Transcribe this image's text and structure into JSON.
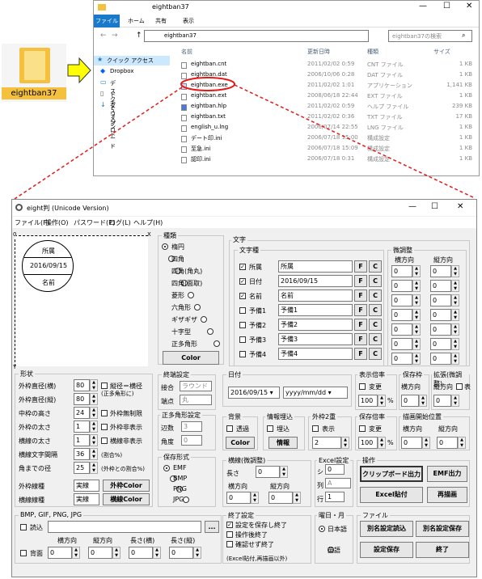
{
  "desktop_icon_label": "eightban37",
  "explorer": {
    "title": "eightban37",
    "tabs": [
      "ファイル",
      "ホーム",
      "共有",
      "表示"
    ],
    "path": "eightban37",
    "search_placeholder": "eightban37の検索",
    "col_name": "名前",
    "col_date": "更新日時",
    "col_type": "種類",
    "col_size": "サイズ",
    "nav": [
      "クイック アクセス",
      "Dropbox",
      "デスクトップ",
      "ドキュメント",
      "ダウンロード"
    ],
    "files": [
      {
        "name": "eightban.cnt",
        "date": "2011/02/02 0:59",
        "type": "CNT ファイル",
        "size": "1 KB"
      },
      {
        "name": "eightban.dat",
        "date": "2006/10/06 0:28",
        "type": "DAT ファイル",
        "size": "1 KB"
      },
      {
        "name": "eightban.exe",
        "date": "2011/02/02 1:01",
        "type": "アプリケーション",
        "size": "1,141 KB"
      },
      {
        "name": "eightban.ext",
        "date": "2008/06/18 22:44",
        "type": "EXT ファイル",
        "size": "1 KB"
      },
      {
        "name": "eightban.hlp",
        "date": "2011/02/02 0:59",
        "type": "ヘルプ ファイル",
        "size": "239 KB"
      },
      {
        "name": "eightban.txt",
        "date": "2011/02/02 0:36",
        "type": "TXT ファイル",
        "size": "17 KB"
      },
      {
        "name": "english_u.lng",
        "date": "2006/07/14 22:55",
        "type": "LNG ファイル",
        "size": "1 KB"
      },
      {
        "name": "デート印.ini",
        "date": "2006/07/18 15:00",
        "type": "構成設定",
        "size": "1 KB"
      },
      {
        "name": "至急.ini",
        "date": "2006/07/18 15:09",
        "type": "構成設定",
        "size": "1 KB"
      },
      {
        "name": "認印.ini",
        "date": "2006/07/18 0:31",
        "type": "構成設定",
        "size": "1 KB"
      }
    ]
  },
  "app": {
    "title": "eight判 (Unicode Version)",
    "menu": [
      "ファイル(F)",
      "操作(O)",
      "パスワード(P)",
      "ログ(L)",
      "ヘルプ(H)"
    ],
    "preview": {
      "x_label": "X",
      "y_label": "Y",
      "o_label": "0",
      "top": "所属",
      "date": "2016/09/15",
      "bottom": "名前"
    },
    "shape": {
      "title": "種類",
      "options": [
        "楕円",
        "四角",
        "四角(角丸)",
        "四角(面取)",
        "菱形",
        "六角形",
        "ギザギザ",
        "十字型",
        "正多角形"
      ],
      "color_btn": "Color"
    },
    "text": {
      "title": "文字",
      "kind": "文字種",
      "rows": [
        {
          "on": true,
          "label": "所属",
          "value": "所属"
        },
        {
          "on": true,
          "label": "日付",
          "value": "2016/09/15"
        },
        {
          "on": true,
          "label": "名前",
          "value": "名前"
        },
        {
          "on": false,
          "label": "予備1",
          "value": "予備1"
        },
        {
          "on": false,
          "label": "予備2",
          "value": "予備2"
        },
        {
          "on": false,
          "label": "予備3",
          "value": "予備3"
        },
        {
          "on": false,
          "label": "予備4",
          "value": "予備4"
        }
      ],
      "f": "F",
      "c": "C",
      "adjust": "微調整",
      "horiz": "横方向",
      "vert": "縦方向",
      "zero": "0"
    },
    "form": {
      "title": "形状",
      "rows": [
        {
          "label": "外枠直径(横)",
          "value": "80",
          "chk": "縦径＝横径",
          "chk2": "(正多角形に)"
        },
        {
          "label": "外枠直径(縦)",
          "value": "80"
        },
        {
          "label": "中枠の高さ",
          "value": "24",
          "chk": "外枠無制限"
        },
        {
          "label": "外枠の太さ",
          "value": "1",
          "chk": "外枠非表示"
        },
        {
          "label": "横線の太さ",
          "value": "1",
          "chk": "横線非表示"
        },
        {
          "label": "横線文字間隔",
          "value": "36",
          "note": "(割合%)"
        },
        {
          "label": "角までの径",
          "value": "25",
          "note": "(外枠との割合%)"
        }
      ],
      "outer_line": "外枠線種",
      "outer_val": "実線",
      "outer_btn": "外枠Color",
      "h_line": "横線線種",
      "h_val": "実線",
      "h_btn": "横線Color"
    },
    "terminal": {
      "title": "終端設定",
      "join": "接合",
      "join_val": "ラウンド",
      "end": "端点",
      "end_val": "丸"
    },
    "polygon": {
      "title": "正多角形設定",
      "sides": "辺数",
      "sides_val": "3",
      "angle": "角度",
      "angle_val": "0"
    },
    "save_fmt": {
      "title": "保存形式",
      "options": [
        "EMF",
        "BMP",
        "PNG",
        "JPG"
      ]
    },
    "date": {
      "title": "日付",
      "value": "2016/09/15",
      "fmt": "yyyy/mm/dd"
    },
    "bg": {
      "title": "背景",
      "transparent": "透過",
      "color": "Color"
    },
    "info": {
      "title": "情報埋込",
      "embed": "埋込",
      "btn": "情報"
    },
    "double": {
      "title": "外枠2重",
      "show": "表示",
      "value": "2"
    },
    "hline_adj": {
      "title": "横線(微調整)",
      "len": "長さ",
      "len_val": "0",
      "horiz": "横方向",
      "vert": "縦方向",
      "h_val": "0",
      "v_val": "0"
    },
    "excel": {
      "title": "Excel設定",
      "sh": "シ",
      "sh_val": "0",
      "col": "列",
      "col_val": "A",
      "row": "行",
      "row_val": "1"
    },
    "ops": {
      "title": "操作",
      "clip": "クリップボード出力",
      "emf": "EMF出力",
      "excel_paste": "Excel貼付",
      "redraw": "再描画"
    },
    "disp_scale": {
      "title": "表示倍率",
      "change": "変更",
      "value": "100",
      "pct": "%"
    },
    "save_frame": {
      "title": "保存枠",
      "horiz": "横方向",
      "h_val": "0"
    },
    "enlarge": {
      "title": "拡張(微調整)",
      "vert": "縦方向",
      "v_val": "0",
      "show": "表"
    },
    "save_scale": {
      "title": "保存倍率",
      "change": "変更",
      "value": "100",
      "pct": "%"
    },
    "draw_start": {
      "title": "描画開始位置",
      "horiz": "横方向",
      "vert": "縦方向",
      "h_val": "0",
      "v_val": "0"
    },
    "bmp": {
      "title": "BMP, GIF, PNG, JPG",
      "read": "読込",
      "browse": "...",
      "bg": "背面",
      "horiz": "横方向",
      "vert": "縦方向",
      "lh": "長さ(横)",
      "lv": "長さ(縦)",
      "vals": [
        "0",
        "0",
        "0",
        "0"
      ]
    },
    "exit": {
      "title": "終了設定",
      "opts": [
        "設定を保存し終了",
        "操作後終了",
        "確認せず終了"
      ],
      "note": "(Excel貼付,再描画以外)"
    },
    "week": {
      "title": "曜日・月",
      "ja": "日本語",
      "en": "英語"
    },
    "file": {
      "title": "ファイル",
      "load": "別名設定読込",
      "save_as": "別名設定保存",
      "save": "設定保存",
      "exit": "終了"
    }
  },
  "colors": {
    "accent": "#e61919",
    "arrow": "#ffff00",
    "ribbon": "#1979ca",
    "folder": "#f4c03d"
  }
}
